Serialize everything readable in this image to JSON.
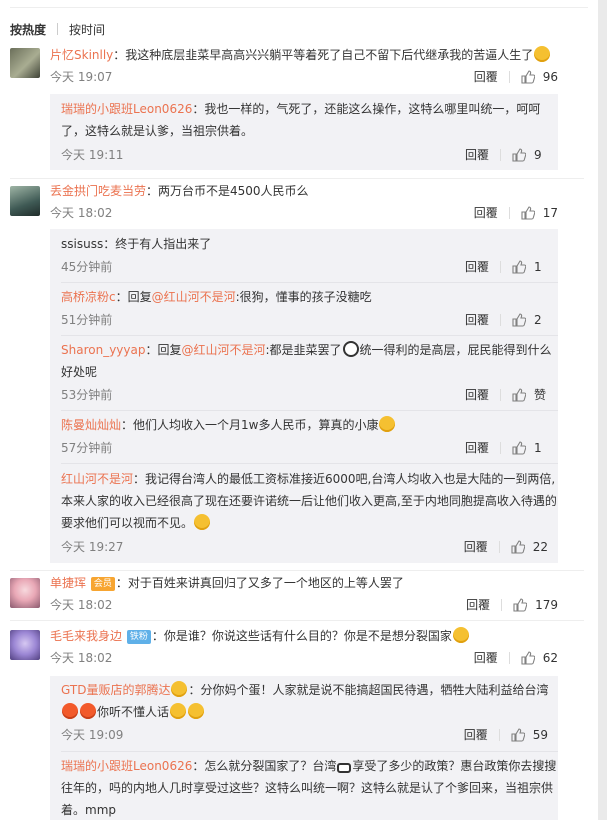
{
  "sort": {
    "hot": "按热度",
    "time": "按时间"
  },
  "reply_label": "回覆",
  "comments": [
    {
      "user": "片忆Skinlly",
      "text": "：我这种底层韭菜早高高兴兴躺平等着死了自己不留下后代继承我的苦逼人生了",
      "time": "今天 19:07",
      "likes": "96",
      "replies": [
        {
          "user": "瑞瑞的小跟班Leon0626",
          "text": "：我也一样的，气死了，还能这么操作，这特么哪里叫统一，呵呵了，这特么就是认爹，当祖宗供着。",
          "time": "今天 19:11",
          "likes": "9"
        }
      ]
    },
    {
      "user": "丢金拱门吃麦当劳",
      "text": "：两万台币不是4500人民币么",
      "time": "今天 18:02",
      "likes": "17",
      "replies": [
        {
          "user": "ssisuss",
          "text": "：终于有人指出来了",
          "time": "45分钟前",
          "likes": "1"
        },
        {
          "user": "高桥凉粉c",
          "text": "：回复",
          "mention": "@红山河不是河",
          "text2": ":很狗，懂事的孩子没糖吃",
          "time": "51分钟前",
          "likes": "2"
        },
        {
          "user": "Sharon_yyyap",
          "text": "：回复",
          "mention": "@红山河不是河",
          "text2": ":都是韭菜罢了",
          "text3": "统一得利的是高层，屁民能得到什么好处呢",
          "time": "53分钟前",
          "likes": "赞"
        },
        {
          "user": "陈曼灿灿灿",
          "text": "：他们人均收入一个月1w多人民币，算真的小康",
          "time": "57分钟前",
          "likes": "1"
        },
        {
          "user": "红山河不是河",
          "text": "：我记得台湾人的最低工资标准接近6000吧,台湾人均收入也是大陆的一到两倍,本来人家的收入已经很高了现在还要许诺统一后让他们收入更高,至于内地同胞提高收入待遇的要求他们可以视而不见。",
          "time": "今天 19:27",
          "likes": "22"
        }
      ]
    },
    {
      "user": "单捷珲",
      "badge": "会员",
      "text": "：对于百姓来讲真回归了又多了一个地区的上等人罢了",
      "time": "今天 18:02",
      "likes": "179",
      "replies": []
    },
    {
      "user": "毛毛来我身边",
      "badge": "铁粉",
      "text": "：你是谁？你说这些话有什么目的？你是不是想分裂国家",
      "time": "今天 18:02",
      "likes": "62",
      "replies": [
        {
          "user": "GTD量贩店的郭腾达",
          "text": "：分你妈个蛋！人家就是说不能搞超国民待遇，牺牲大陆利益给台湾",
          "text3": "你听不懂人话",
          "time": "今天 19:09",
          "likes": "59"
        },
        {
          "user": "瑞瑞的小跟班Leon0626",
          "text": "：怎么就分裂国家了？台湾",
          "text2": "享受了多少的政策？惠台政策你去搜搜往年的，吗的内地人几时享受过这些？这特么叫统一啊？这特么就是认了个爹回来，当祖宗供着。mmp",
          "time": "",
          "likes": ""
        }
      ]
    }
  ],
  "colors": {
    "name": "#eb7350",
    "meta": "#808080",
    "reply_bg": "#f2f2f5"
  }
}
